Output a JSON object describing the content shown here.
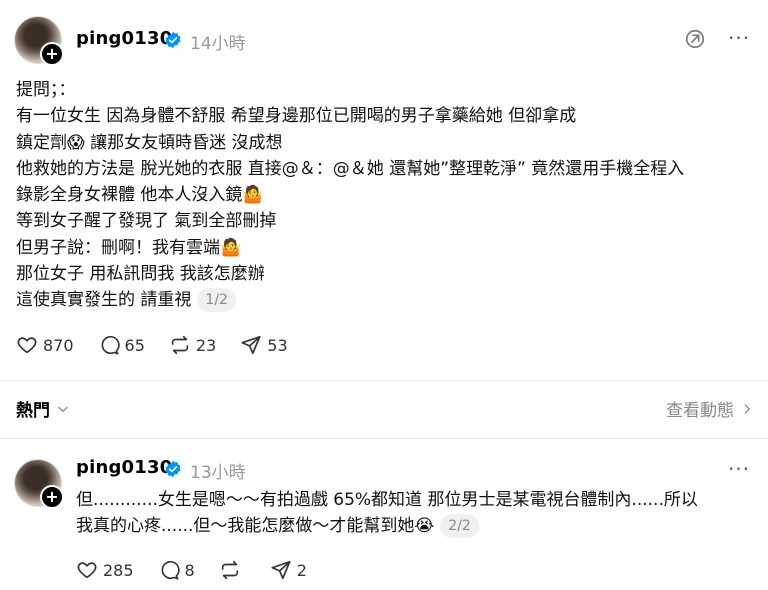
{
  "post1": {
    "username": "ping0130",
    "time": "14小時",
    "more_label": "···",
    "lines": [
      "提問；：",
      "有一位女生 因為身體不舒服 希望身邊那位已開喝的男子拿藥給她 但卻拿成",
      "鎮定劑😱 讓那女友頓時昏迷 沒成想",
      "他救她的方法是 脫光她的衣服 直接@＆：@＆她 還幫她”整理乾淨” 竟然還用手機全程入",
      "錄影全身女裸體 他本人沒入鏡🤷",
      "等到女子醒了發現了 氣到全部刪掉",
      "但男子說：刪啊！我有雲端🤷",
      "那位女子 用私訊問我 我該怎麼辦",
      "這使真實發生的 請重視"
    ],
    "page_pill": "1/2",
    "likes": "870",
    "comments": "65",
    "reposts": "23",
    "shares": "53"
  },
  "section": {
    "tab_label": "熱門",
    "view_label": "查看動態"
  },
  "post2": {
    "username": "ping0130",
    "time": "13小時",
    "more_label": "···",
    "lines": [
      "但............女生是嗯～～有拍過戲 65%都知道 那位男士是某電視台體制內......所以",
      "我真的心疼......但～我能怎麼做～才能幫到她😭"
    ],
    "page_pill": "2/2",
    "likes": "285",
    "comments": "8",
    "reposts": "",
    "shares": "2"
  },
  "colors": {
    "verified": "#0095f6",
    "muted": "#999999"
  }
}
